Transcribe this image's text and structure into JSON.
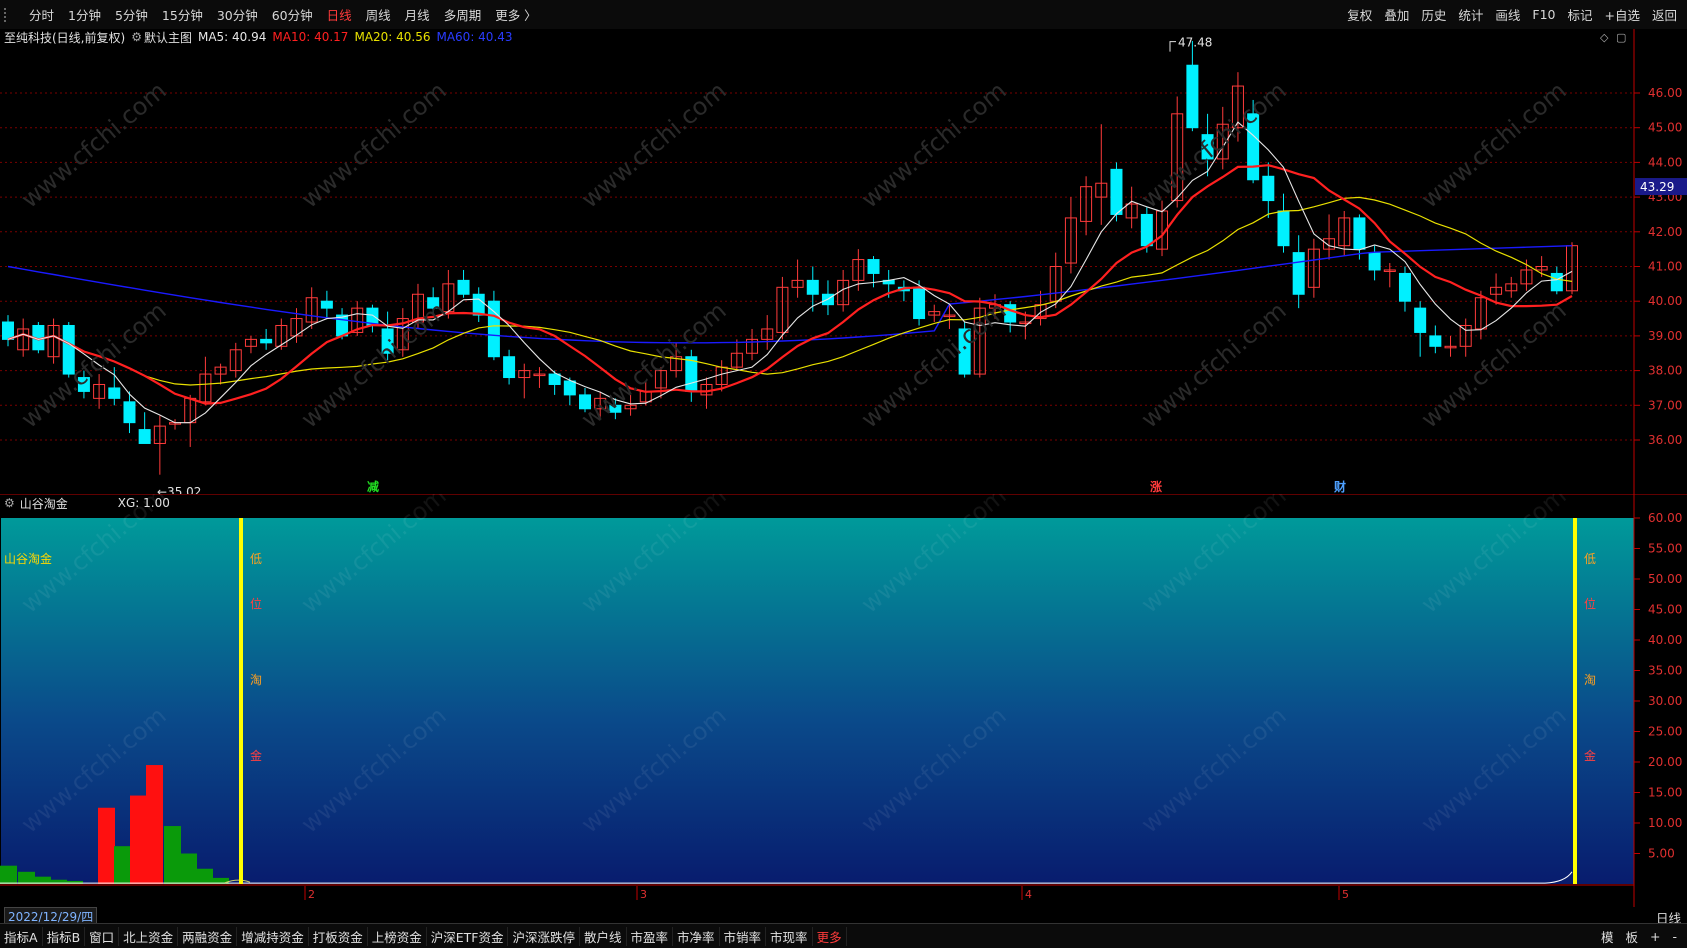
{
  "toolbar": {
    "periods": [
      {
        "label": "分时",
        "active": false
      },
      {
        "label": "1分钟",
        "active": false
      },
      {
        "label": "5分钟",
        "active": false
      },
      {
        "label": "15分钟",
        "active": false
      },
      {
        "label": "30分钟",
        "active": false
      },
      {
        "label": "60分钟",
        "active": false
      },
      {
        "label": "日线",
        "active": true
      },
      {
        "label": "周线",
        "active": false
      },
      {
        "label": "月线",
        "active": false
      },
      {
        "label": "多周期",
        "active": false
      },
      {
        "label": "更多 〉",
        "active": false
      }
    ],
    "right": [
      "复权",
      "叠加",
      "历史",
      "统计",
      "画线",
      "F10",
      "标记",
      "+自选",
      "返回"
    ]
  },
  "info": {
    "stock": "至纯科技(日线,前复权)",
    "template": "默认主图",
    "ma5": "MA5: 40.94",
    "ma10": "MA10: 40.17",
    "ma20": "MA20: 40.56",
    "ma60": "MA60: 40.43"
  },
  "colors": {
    "ma5": "#e6e6e6",
    "ma10": "#ff2020",
    "ma20": "#e8e000",
    "ma60": "#1a1aff",
    "up": "#ff3b3b",
    "down": "#00f0ff",
    "grid": "#7a0000",
    "axis": "#c00000"
  },
  "main_chart": {
    "y_ticks": [
      "46.00",
      "45.00",
      "44.00",
      "43.00",
      "42.00",
      "41.00",
      "40.00",
      "39.00",
      "38.00",
      "37.00",
      "36.00"
    ],
    "current_price": "43.29",
    "high_label": "47.48",
    "low_label": "←35.02",
    "markers": [
      {
        "text": "减",
        "color": "#21e021"
      },
      {
        "text": "涨",
        "color": "#ff3b3b"
      },
      {
        "text": "财",
        "color": "#4ea0ff"
      }
    ]
  },
  "sub_chart": {
    "name": "山谷淘金",
    "xg": "XG: 1.00",
    "inner_label": "山谷淘金",
    "y_ticks": [
      "60.00",
      "55.00",
      "50.00",
      "45.00",
      "40.00",
      "35.00",
      "30.00",
      "25.00",
      "20.00",
      "15.00",
      "10.00",
      "5.00"
    ],
    "signal_chars": [
      "低",
      "位",
      "淘",
      "金"
    ],
    "x_marks": [
      "2",
      "3",
      "4",
      "5"
    ]
  },
  "date_cursor": "2022/12/29/四",
  "freq": "日线",
  "bottom_tabs": [
    "指标A",
    "指标B",
    "窗口",
    "北上资金",
    "两融资金",
    "增减持资金",
    "打板资金",
    "上榜资金",
    "沪深ETF资金",
    "沪深涨跌停",
    "散户线",
    "市盈率",
    "市净率",
    "市销率",
    "市现率",
    "更多"
  ],
  "bottom_right": [
    "模",
    "板",
    "+",
    "-"
  ],
  "watermark": "www.cfchi.com"
}
